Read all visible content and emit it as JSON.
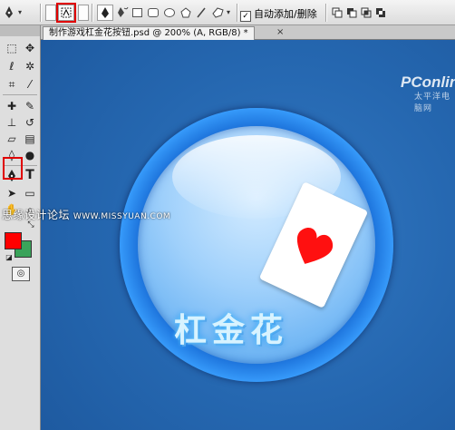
{
  "options_bar": {
    "auto_add_label": "自动添加/删除",
    "auto_add_checked": true,
    "colors": {
      "highlight": "#e00000"
    }
  },
  "toolbox": {
    "type_tool_label": "T",
    "swatches": {
      "foreground": "#ff0000",
      "background": "#3aa35a"
    }
  },
  "document": {
    "tab_title": "制作游戏杠金花按钮.psd @ 200% (A, RGB/8) *",
    "close_label": "×"
  },
  "canvas": {
    "watermark_logo": "PConline",
    "watermark_cn": "太平洋电脑网",
    "watermark_site_cn": "思缘设计论坛",
    "watermark_site_url": "WWW.MISSYUAN.COM",
    "button_text": "杠金花",
    "card_suit": "heart",
    "colors": {
      "card_heart": "#ff1010",
      "button_rim": "#1a6fd8",
      "button_face": "#9fd0fb"
    }
  }
}
